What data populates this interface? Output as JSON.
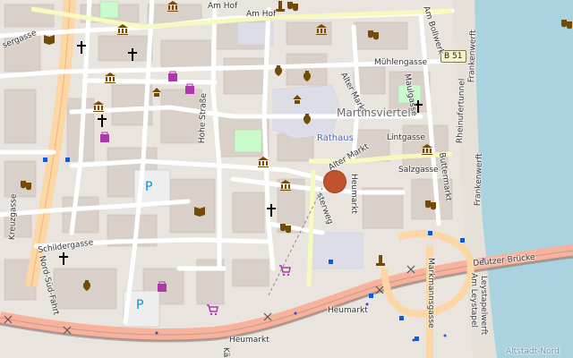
{
  "map": {
    "streets": {
      "am_hof_1": "Am Hof",
      "am_hof_2": "Am Hof",
      "am_bollwerk": "Am Bollwerk",
      "muehlengasse": "Mühlengasse",
      "maulgasse": "Maulgasse",
      "alter_markt_1": "Alter Markt",
      "alter_markt_2": "Alter Markt",
      "lintgasse": "Lintgasse",
      "salzgasse": "Salzgasse",
      "hohe_strasse": "Hohe Straße",
      "buttermarkt": "Buttermarkt",
      "frankenwerf_1": "Frankenwerft",
      "frankenwerf_2": "Frankenwerft",
      "rheinufertunnel": "Rheinufertunnel",
      "heumarkt_1": "Heumarkt",
      "heumarkt_2": "Heumarkt",
      "heumarkt_3": "Heumarkt",
      "markmannsgasse": "Markmannsgasse",
      "deutzer_bruecke": "Deutzer Brücke",
      "am_leystapel": "Am Leystapel",
      "leystapelwerft": "Leystapelwerft",
      "schildergasse": "Schildergasse",
      "nord_sued_fahrt": "Nord-Süd-Fahrt",
      "kreuzgasse": "Kreuzgasse",
      "sergasse": "sergasse",
      "sterwerg": "sterweg",
      "kae": "Käs"
    },
    "places": {
      "district": "Martinsviertel",
      "rathaus": "Rathaus",
      "altstadt_nord": "Altstadt-Nord"
    },
    "road_shield": "B 51",
    "parking_symbol": "P",
    "colors": {
      "background": "#f2efe9",
      "river": "#aad3df",
      "pedestrian": "#dddde8",
      "building": "#d9d0c9",
      "primary_road": "#fcd6a4",
      "trunk_road": "#f9b29c",
      "pin": "#c0532e"
    }
  }
}
